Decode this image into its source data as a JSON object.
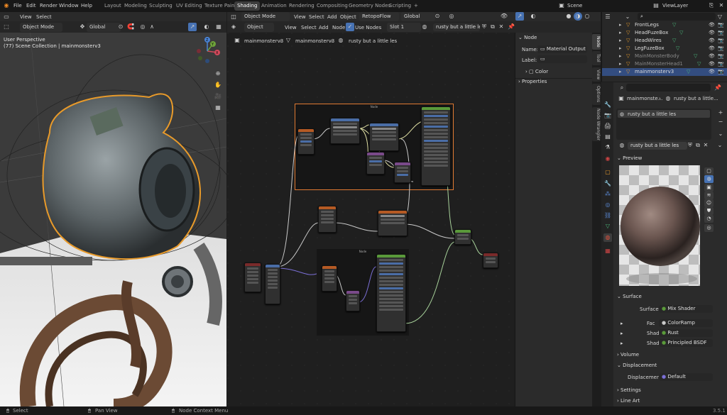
{
  "top_menu": {
    "items": [
      "File",
      "Edit",
      "Render",
      "Window",
      "Help"
    ],
    "workspaces": [
      "Layout",
      "Modeling",
      "Sculpting",
      "UV Editing",
      "Texture Paint",
      "Shading",
      "Animation",
      "Rendering",
      "Compositing",
      "Geometry Nodes",
      "Scripting"
    ],
    "active_workspace": "Shading",
    "add_tab": "+",
    "scene_label": "Scene",
    "view_layer": "ViewLayer"
  },
  "viewport": {
    "header_menu": [
      "View",
      "Select"
    ],
    "mode": "Object Mode",
    "toolbar_mode": "Object Mode",
    "orientation": "Global",
    "view_label": "User Perspective",
    "collection_label": "(77) Scene Collection | mainmonsterv3",
    "gizmo": {
      "x": "X",
      "y": "Y",
      "z": "Z"
    }
  },
  "node_editor_top": {
    "mode": "Object Mode",
    "menu": [
      "View",
      "Select",
      "Add",
      "Object"
    ],
    "addon": "RetopoFlow",
    "orientation": "Global"
  },
  "node_editor": {
    "type": "Object",
    "menu": [
      "View",
      "Select",
      "Add",
      "Node"
    ],
    "use_nodes_label": "Use Nodes",
    "slot": "Slot 1",
    "material": "rusty but a little les",
    "breadcrumb": [
      "mainmonsterv3",
      "mainmonsterv3",
      "rusty but a little les"
    ],
    "frame_label": "Node",
    "frame2_label": "Node"
  },
  "node_sidebar": {
    "section": "Node",
    "name_label": "Name:",
    "name_value": "Material Output",
    "label_label": "Label:",
    "color_label": "Color",
    "properties_label": "Properties",
    "tabs": [
      "Node",
      "Tool",
      "View",
      "Options",
      "Node Wrangler"
    ]
  },
  "outliner": {
    "rows": [
      {
        "name": "FrontLegs",
        "dim": false
      },
      {
        "name": "HeadFuzeBox",
        "dim": false
      },
      {
        "name": "HeadWires",
        "dim": false
      },
      {
        "name": "LegFuzeBox",
        "dim": false
      },
      {
        "name": "MainMonsterBody",
        "dim": true
      },
      {
        "name": "MainMonsterHead1",
        "dim": true
      },
      {
        "name": "mainmonsterv3",
        "dim": false,
        "selected": true
      }
    ]
  },
  "properties": {
    "breadcrumb_obj": "mainmonste...",
    "breadcrumb_mat": "rusty but a little...",
    "slot_name": "rusty but a little les",
    "material_field": "rusty but a little les",
    "preview_label": "Preview",
    "surface_label": "Surface",
    "surface_rows": [
      {
        "label": "Surface",
        "value": "Mix Shader"
      },
      {
        "label": "Fac",
        "value": "ColorRamp"
      },
      {
        "label": "Shader",
        "value": "Rust"
      },
      {
        "label": "Shader",
        "value": "Principled BSDF"
      }
    ],
    "volume_label": "Volume",
    "displacement_label": "Displacement",
    "displacement_row": {
      "label": "Displacement",
      "value": "Default"
    },
    "settings_label": "Settings",
    "lineart_label": "Line Art"
  },
  "status_bar": {
    "select": "Select",
    "pan": "Pan View",
    "context": "Node Context Menu",
    "version": "3.5.1"
  },
  "colors": {
    "accent_blue": "#4772b3",
    "outline_orange": "#e89a2a",
    "bg": "#1d1d1d"
  }
}
